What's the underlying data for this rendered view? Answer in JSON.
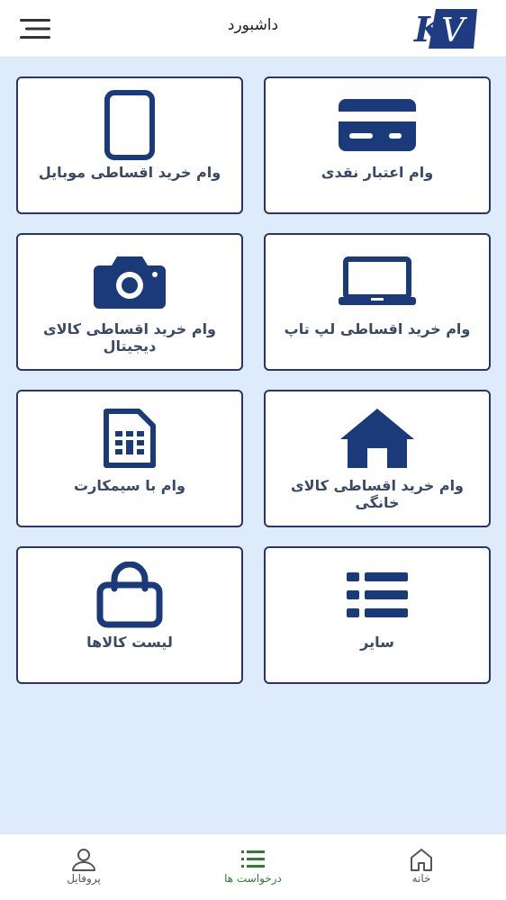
{
  "header": {
    "title": "داشبورد",
    "logo_text": "KV",
    "menu_icon": "hamburger-menu-icon"
  },
  "colors": {
    "accent": "#1b3a7a",
    "card_border": "#2b3566",
    "background": "#deebfb",
    "active_nav": "#2e7d32"
  },
  "cards": [
    {
      "label": "وام اعتبار نقدی",
      "icon": "credit-card-icon"
    },
    {
      "label": "وام خرید اقساطی موبایل",
      "icon": "mobile-phone-icon"
    },
    {
      "label": "وام خرید اقساطی لپ تاپ",
      "icon": "laptop-icon"
    },
    {
      "label": "وام خرید اقساطی کالای دیجیتال",
      "icon": "camera-icon"
    },
    {
      "label": "وام خرید اقساطی کالای خانگی",
      "icon": "home-icon"
    },
    {
      "label": "وام با سیمکارت",
      "icon": "sim-card-icon"
    },
    {
      "label": "سایر",
      "icon": "list-icon"
    },
    {
      "label": "لیست کالاها",
      "icon": "shopping-bag-icon"
    }
  ],
  "nav": {
    "home": {
      "label": "خانه",
      "icon": "home-outline-icon"
    },
    "requests": {
      "label": "درخواست ها",
      "icon": "list-outline-icon",
      "active": true
    },
    "profile": {
      "label": "پروفایل",
      "icon": "user-outline-icon"
    }
  }
}
